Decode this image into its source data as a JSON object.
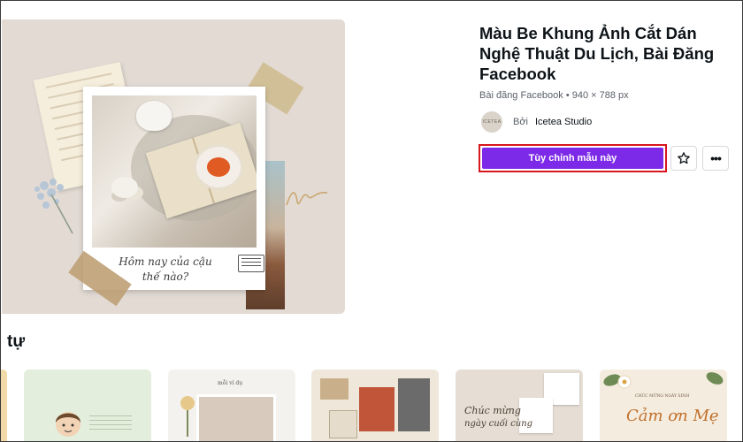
{
  "template": {
    "title": "Màu Be Khung Ảnh Cắt Dán Nghệ Thuật Du Lịch, Bài Đăng Facebook",
    "meta": "Bài đăng Facebook • 940 × 788 px",
    "by_label": "Bởi",
    "author": "Icetea Studio",
    "avatar_text": "ICETEA",
    "cta_label": "Tùy chỉnh mẫu này",
    "star_icon": "star-outline-icon",
    "more_icon": "more-horizontal-icon",
    "more_glyph": "•••"
  },
  "preview": {
    "caption_line1": "Hôm nay của cậu",
    "caption_line2": "thế nào?"
  },
  "similar": {
    "section_title": "tự",
    "card2_text": "mỗi ví dụ",
    "card4_text1": "Chúc mừng",
    "card4_text2": "ngày cuối cùng",
    "card5_header": "CHÚC MỪNG NGÀY SINH",
    "card5_title": "Cảm ơn Mẹ"
  },
  "colors": {
    "accent": "#7d2ae8",
    "highlight_border": "#d7161e",
    "preview_bg": "#e2dad3"
  }
}
